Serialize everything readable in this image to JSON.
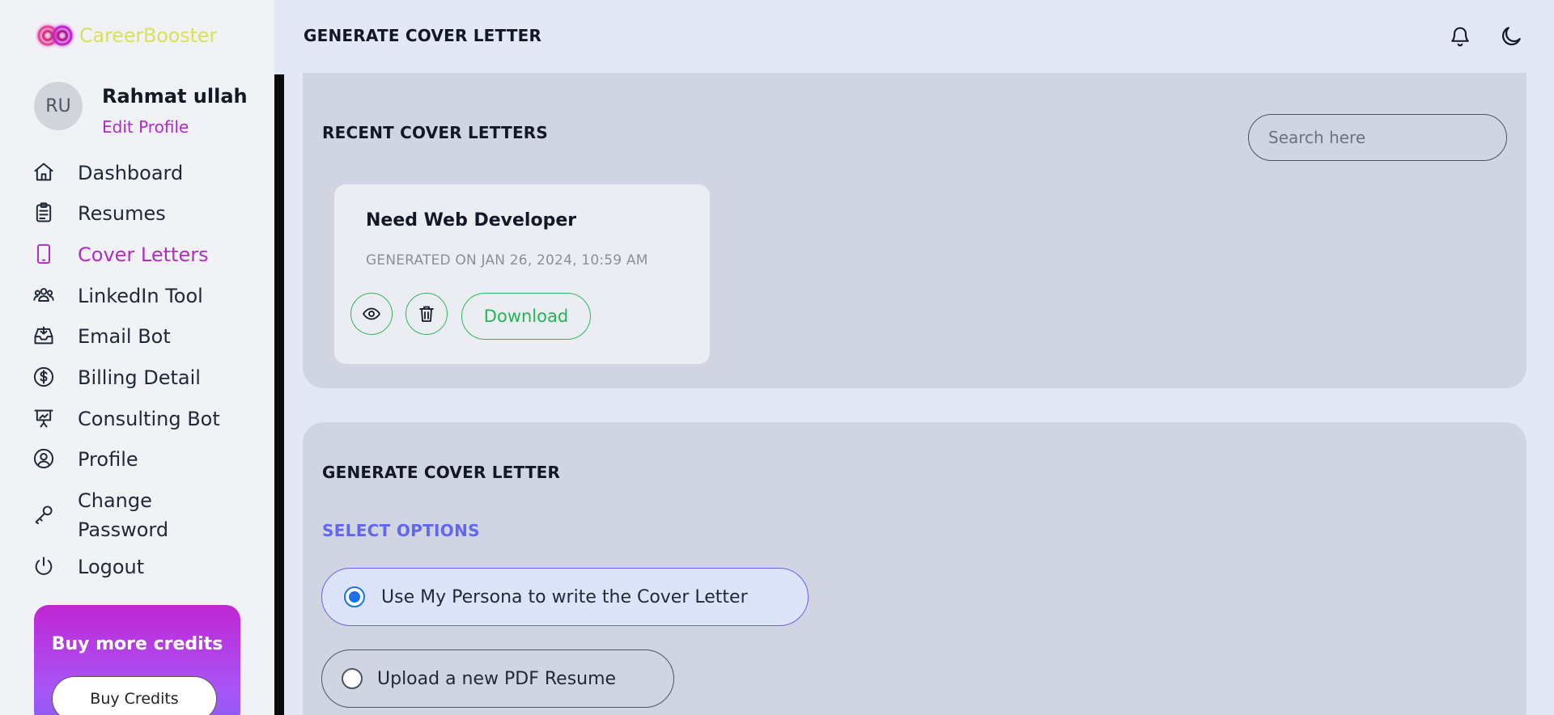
{
  "app": {
    "name": "CareerBooster"
  },
  "user": {
    "initials": "RU",
    "name": "Rahmat ullah",
    "edit_label": "Edit Profile"
  },
  "sidebar": {
    "items": [
      {
        "label": "Dashboard",
        "icon": "home-icon"
      },
      {
        "label": "Resumes",
        "icon": "clipboard-icon"
      },
      {
        "label": "Cover Letters",
        "icon": "tablet-icon",
        "active": true
      },
      {
        "label": "LinkedIn Tool",
        "icon": "users-icon"
      },
      {
        "label": "Email Bot",
        "icon": "inbox-icon"
      },
      {
        "label": "Billing Detail",
        "icon": "dollar-icon"
      },
      {
        "label": "Consulting Bot",
        "icon": "presentation-icon"
      },
      {
        "label": "Profile",
        "icon": "user-circle-icon"
      },
      {
        "label": "Change Password",
        "icon": "key-icon"
      },
      {
        "label": "Logout",
        "icon": "power-icon"
      }
    ],
    "credits": {
      "title": "Buy more credits",
      "button": "Buy Credits"
    }
  },
  "header": {
    "title": "GENERATE COVER LETTER"
  },
  "recent": {
    "title": "RECENT COVER LETTERS",
    "search_placeholder": "Search here",
    "cards": [
      {
        "title": "Need Web Developer",
        "date": "GENERATED ON JAN 26, 2024, 10:59 AM",
        "download_label": "Download"
      }
    ]
  },
  "generate": {
    "title": "GENERATE COVER LETTER",
    "select_label": "SELECT OPTIONS",
    "options": [
      {
        "label": "Use My Persona to write the Cover Letter",
        "checked": true
      },
      {
        "label": "Upload a new PDF Resume",
        "checked": false
      }
    ]
  },
  "colors": {
    "accent": "#b22bc9",
    "brand_text": "#d7e15a",
    "success": "#22b455",
    "option_accent": "#6366f1"
  }
}
